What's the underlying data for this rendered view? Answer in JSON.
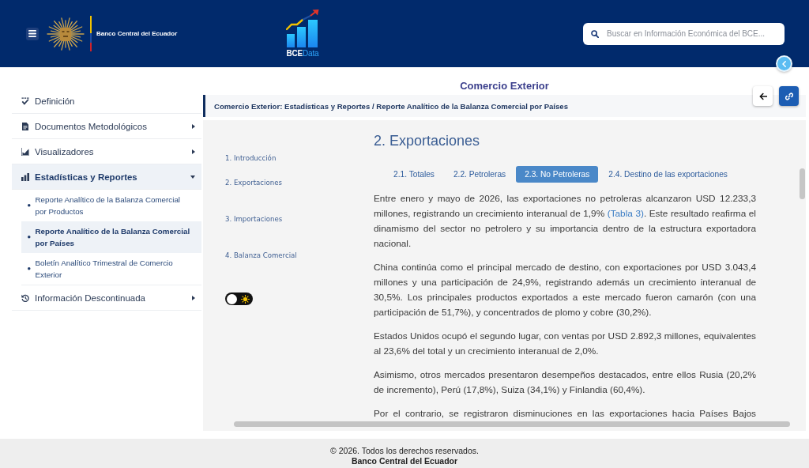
{
  "header": {
    "bank_name": "Banco Central del Ecuador",
    "brand": {
      "strong": "BCE",
      "light": "Data"
    },
    "search": {
      "placeholder": "Buscar en Información Económica del BCE..."
    }
  },
  "sidebar": {
    "items": [
      {
        "kind": "link",
        "label": "Definición",
        "selected": false
      },
      {
        "kind": "menu",
        "label": "Documentos Metodológicos",
        "selected": false,
        "expanded": false
      },
      {
        "kind": "menu",
        "label": "Visualizadores",
        "selected": false,
        "expanded": false
      },
      {
        "kind": "menu",
        "label": "Estadísticas y Reportes",
        "selected": true,
        "expanded": true,
        "children": [
          {
            "label": "Reporte Analítico de la Balanza Comercial por Productos",
            "selected": false
          },
          {
            "label": "Reporte Analítico de la Balanza Comercial por Países",
            "selected": true
          },
          {
            "label": "Boletín Analítico Trimestral de Comercio Exterior",
            "selected": false
          }
        ]
      },
      {
        "kind": "menu",
        "label": "Información Descontinuada",
        "selected": false,
        "expanded": false
      }
    ]
  },
  "main": {
    "title": "Comercio Exterior",
    "breadcrumb": "Comercio Exterior: Estadísticas y Reportes / Reporte Analítico de la Balanza Comercial por Países",
    "section_nav": [
      "1. Introducción",
      "2. Exportaciones",
      "3. Importaciones",
      "4. Balanza Comercial"
    ],
    "theme_toggle": {
      "on": false
    },
    "heading": "2. Exportaciones",
    "tabs": [
      {
        "label": "2.1. Totales",
        "selected": false
      },
      {
        "label": "2.2. Petroleras",
        "selected": false
      },
      {
        "label": "2.3. No Petroleras",
        "selected": true
      },
      {
        "label": "2.4. Destino de las exportaciones",
        "selected": false
      }
    ],
    "paragraphs": [
      {
        "kind": "linked",
        "before": "Entre enero y mayo de 2026, las exportaciones no petroleras alcanzaron USD 12.233,3 millones, registrando un crecimiento interanual de 1,9% ",
        "link": "(Tabla 3)",
        "after": ". Este resultado reafirma el dinamismo del sector no petrolero y su importancia dentro de la estructura exportadora nacional."
      },
      {
        "kind": "plain",
        "text": "China continúa como el principal mercado de destino, con exportaciones por USD 3.043,4 millones y una participación de 24,9%, registrando además un crecimiento interanual de 30,5%. Los principales productos exportados a este mercado fueron camarón (con una participación de 51,7%), y concentrados de plomo y cobre (30,2%)."
      },
      {
        "kind": "plain",
        "text": "Estados Unidos ocupó el segundo lugar, con ventas por USD 2.892,3 millones, equivalentes al 23,6% del total y un crecimiento interanual de 2,0%."
      },
      {
        "kind": "plain",
        "text": "Asimismo, otros mercados presentaron desempeños destacados, entre ellos Rusia (20,2% de incremento), Perú (17,8%), Suiza (34,1%) y Finlandia (60,4%)."
      },
      {
        "kind": "cut",
        "text": "Por el contrario, se registraron disminuciones en las exportaciones hacia Países Bajos"
      }
    ]
  },
  "footer": {
    "copyright": "© 2026. Todos los derechos reservados.",
    "organization": "Banco Central del Ecuador"
  }
}
